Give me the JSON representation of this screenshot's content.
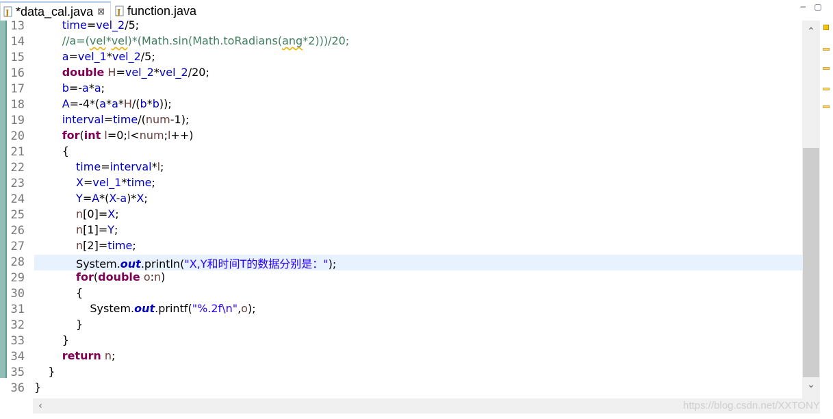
{
  "tabs": [
    {
      "label": "*data_cal.java",
      "close": "⊠",
      "active": true
    },
    {
      "label": "function.java",
      "active": false
    }
  ],
  "window_buttons": {
    "minimize": "−",
    "maximize": "▢"
  },
  "editor": {
    "current_line": 28,
    "lines": [
      {
        "num": "13",
        "html": "        <span class=\"fld\">time</span>=<span class=\"fld\">vel_2</span>/5;"
      },
      {
        "num": "14",
        "html": "        <span class=\"cmt\">//a=(<span class=\"sq\">vel</span>*<span class=\"sq\">vel</span>)*(Math.sin(Math.toRadians(<span class=\"sq\">ang</span>*2)))/20;</span>"
      },
      {
        "num": "15",
        "html": "        <span class=\"fld\">a</span>=<span class=\"fld\">vel_1</span>*<span class=\"fld\">vel_2</span>/5;"
      },
      {
        "num": "16",
        "html": "        <span class=\"kw\">double</span> <span class=\"var\">H</span>=<span class=\"fld\">vel_2</span>*<span class=\"fld\">vel_2</span>/20;"
      },
      {
        "num": "17",
        "html": "        <span class=\"fld\">b</span>=-<span class=\"fld\">a</span>*<span class=\"fld\">a</span>;"
      },
      {
        "num": "18",
        "html": "        <span class=\"fld\">A</span>=-4*(<span class=\"fld\">a</span>*<span class=\"fld\">a</span>*<span class=\"var\">H</span>/(<span class=\"fld\">b</span>*<span class=\"fld\">b</span>));"
      },
      {
        "num": "19",
        "html": "        <span class=\"fld\">interval</span>=<span class=\"fld\">time</span>/(<span class=\"var\">num</span>-1);"
      },
      {
        "num": "20",
        "html": "        <span class=\"kw\">for</span>(<span class=\"kw\">int</span> <span class=\"var\">l</span>=0;<span class=\"var\">l</span>&lt;<span class=\"var\">num</span>;<span class=\"var\">l</span>++)"
      },
      {
        "num": "21",
        "html": "        {"
      },
      {
        "num": "22",
        "html": "            <span class=\"fld\">time</span>=<span class=\"fld\">interval</span>*<span class=\"var\">l</span>;"
      },
      {
        "num": "23",
        "html": "            <span class=\"fld\">X</span>=<span class=\"fld\">vel_1</span>*<span class=\"fld\">time</span>;"
      },
      {
        "num": "24",
        "html": "            <span class=\"fld\">Y</span>=<span class=\"fld\">A</span>*(<span class=\"fld\">X</span>-<span class=\"fld\">a</span>)*<span class=\"fld\">X</span>;"
      },
      {
        "num": "25",
        "html": "            <span class=\"var\">n</span>[0]=<span class=\"fld\">X</span>;"
      },
      {
        "num": "26",
        "html": "            <span class=\"var\">n</span>[1]=<span class=\"fld\">Y</span>;"
      },
      {
        "num": "27",
        "html": "            <span class=\"var\">n</span>[2]=<span class=\"fld\">time</span>;"
      },
      {
        "num": "28",
        "html": "            System.<span class=\"sfld\">out</span>.println(<span class=\"str\">\"X,Y和时间T的数据分别是：\"</span>);"
      },
      {
        "num": "29",
        "html": "            <span class=\"kw\">for</span>(<span class=\"kw\">double</span> <span class=\"var\">o</span>:<span class=\"var\">n</span>)"
      },
      {
        "num": "30",
        "html": "            {"
      },
      {
        "num": "31",
        "html": "                System.<span class=\"sfld\">out</span>.printf(<span class=\"str\">\"%.2f\\n\"</span>,<span class=\"var\">o</span>);"
      },
      {
        "num": "32",
        "html": "            }"
      },
      {
        "num": "33",
        "html": "        }"
      },
      {
        "num": "34",
        "html": "        <span class=\"kw\">return</span> <span class=\"var\">n</span>;"
      },
      {
        "num": "35",
        "html": "    }"
      },
      {
        "num": "36",
        "html": "}"
      }
    ]
  },
  "scroll": {
    "up": "⌃",
    "down": "⌄",
    "left": "‹",
    "vertical_thumb_fraction": 0.6
  },
  "watermark": "https://blog.csdn.net/XXTONY"
}
